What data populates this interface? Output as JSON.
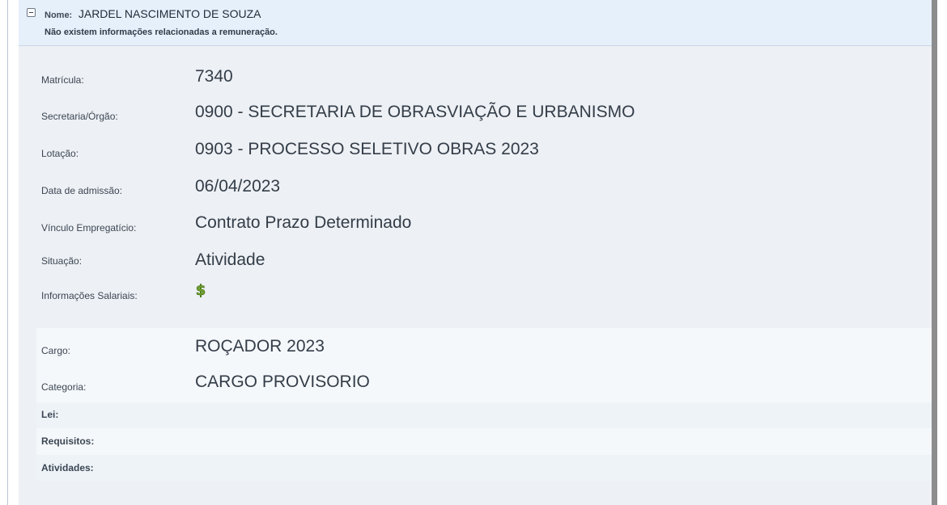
{
  "header": {
    "name_label": "Nome:",
    "name_value": "JARDEL NASCIMENTO DE SOUZA",
    "note": "Não existem informações relacionadas a remuneração."
  },
  "fields": [
    {
      "label": "Matrícula:",
      "value": "7340"
    },
    {
      "label": "Secretaria/Órgão:",
      "value": "0900 - SECRETARIA DE OBRASVIAÇÃO E URBANISMO"
    },
    {
      "label": "Lotação:",
      "value": "0903 - PROCESSO SELETIVO OBRAS 2023"
    },
    {
      "label": "Data de admissão:",
      "value": "06/04/2023"
    },
    {
      "label": "Vínculo Empregatício:",
      "value": "Contrato Prazo Determinado"
    },
    {
      "label": "Situação:",
      "value": "Atividade"
    },
    {
      "label": "Informações Salariais:",
      "value": ""
    }
  ],
  "cargo": [
    {
      "label": "Cargo:",
      "value": "ROÇADOR 2023"
    },
    {
      "label": "Categoria:",
      "value": "CARGO PROVISORIO"
    },
    {
      "label": "Lei:",
      "value": ""
    },
    {
      "label": "Requisitos:",
      "value": ""
    },
    {
      "label": "Atividades:",
      "value": ""
    }
  ],
  "icons": {
    "salary_icon": "dollar-sign-icon",
    "collapse_icon": "minus-box-icon"
  },
  "colors": {
    "header_bg": "#e6f0fb",
    "panel_bg": "#edf0f4",
    "band_bg": "#f5f8fb",
    "money_green": "#6fa12a"
  }
}
